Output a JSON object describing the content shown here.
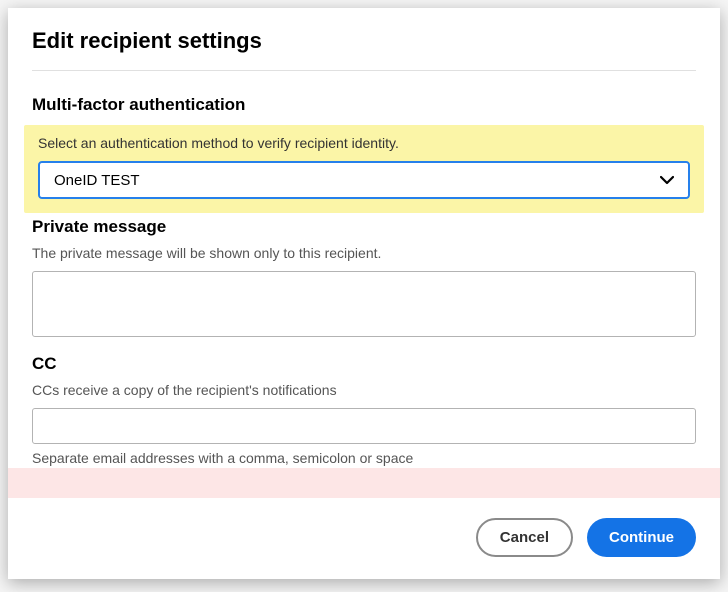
{
  "dialog": {
    "title": "Edit recipient settings"
  },
  "mfa": {
    "heading": "Multi-factor authentication",
    "helper": "Select an authentication method to verify recipient identity.",
    "selected": "OneID TEST"
  },
  "private_message": {
    "heading": "Private message",
    "helper": "The private message will be shown only to this recipient.",
    "value": ""
  },
  "cc": {
    "heading": "CC",
    "helper": "CCs receive a copy of the recipient's notifications",
    "value": "",
    "hint": "Separate email addresses with a comma, semicolon or space"
  },
  "buttons": {
    "cancel": "Cancel",
    "continue": "Continue"
  }
}
